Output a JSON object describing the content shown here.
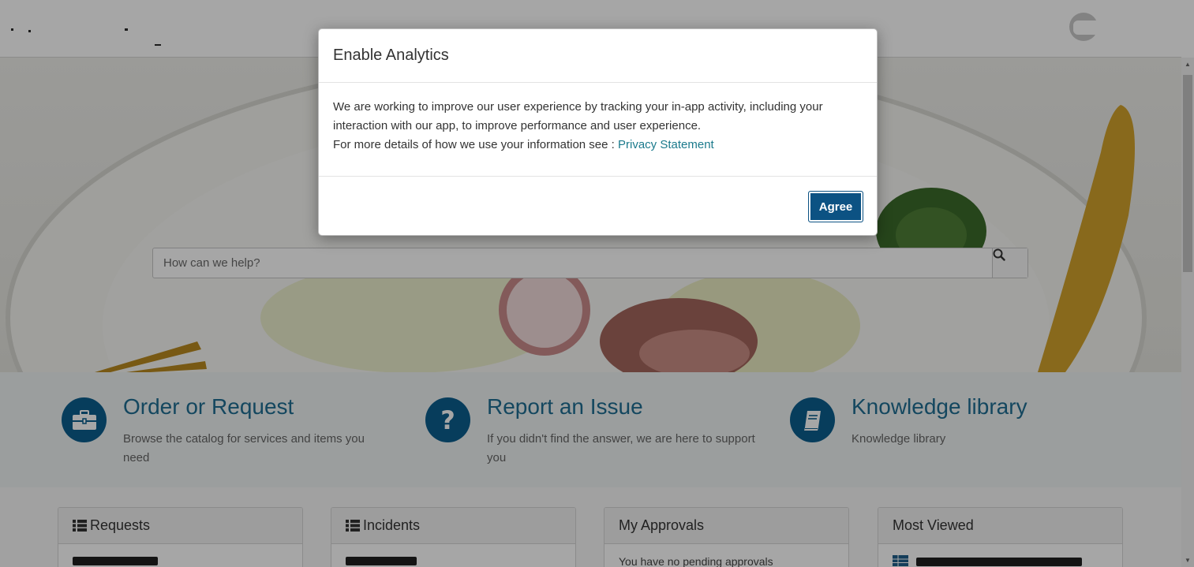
{
  "header": {
    "logo_alt": "Company logo (redacted)"
  },
  "search": {
    "placeholder": "How can we help?"
  },
  "features": [
    {
      "title": "Order or Request",
      "desc": "Browse the catalog for services and items you need",
      "icon": "briefcase-icon"
    },
    {
      "title": "Report an Issue",
      "desc": "If you didn't find the answer, we are here to support you",
      "icon": "question-icon"
    },
    {
      "title": "Knowledge library",
      "desc": "Knowledge library",
      "icon": "book-icon"
    }
  ],
  "cards": [
    {
      "title": "Requests",
      "icon": "list-icon"
    },
    {
      "title": "Incidents",
      "icon": "list-icon"
    },
    {
      "title": "My Approvals",
      "body": "You have no pending approvals"
    },
    {
      "title": "Most Viewed",
      "icon": "table-icon"
    }
  ],
  "modal": {
    "title": "Enable Analytics",
    "body_line1": "We are working to improve our user experience by tracking your in-app activity, including your interaction with our app, to improve performance and user experience.",
    "body_line2_prefix": "For more details of how we use your information see : ",
    "privacy_link": "Privacy Statement",
    "agree_label": "Agree"
  },
  "colors": {
    "accent": "#0b5e8e",
    "button": "#0c5283",
    "link": "#1b7a8c"
  }
}
